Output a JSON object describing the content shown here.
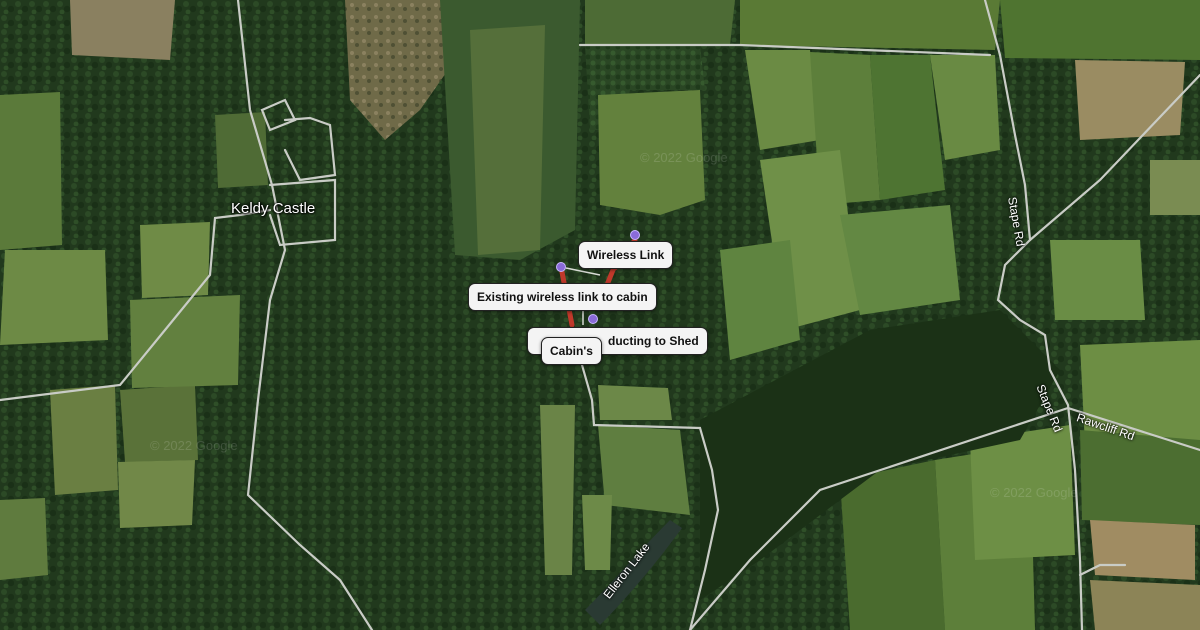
{
  "map": {
    "places": [
      {
        "name": "Keldy Castle"
      }
    ],
    "roads": [
      {
        "name": "Stape Rd"
      },
      {
        "name": "Stape Rd"
      },
      {
        "name": "Rawcliff Rd"
      }
    ],
    "water": [
      {
        "name": "Elleron Lake"
      }
    ],
    "callouts": [
      {
        "label": "Wireless Link"
      },
      {
        "label": "Existing wireless link to cabin"
      },
      {
        "label": "Cabin's"
      },
      {
        "label": "Cable in ducting to Shed",
        "visible_text": "ducting to Shed"
      }
    ],
    "watermarks": [
      "© 2022 Google",
      "© 2022 Google",
      "© 2022 Google"
    ],
    "colors": {
      "forest": "#24401f",
      "field": "#5d7a3d",
      "road": "#c9ccc6",
      "link_line": "#c0392b",
      "marker": "#8a6bd8",
      "callout_bg": "#f4f4f4"
    }
  }
}
